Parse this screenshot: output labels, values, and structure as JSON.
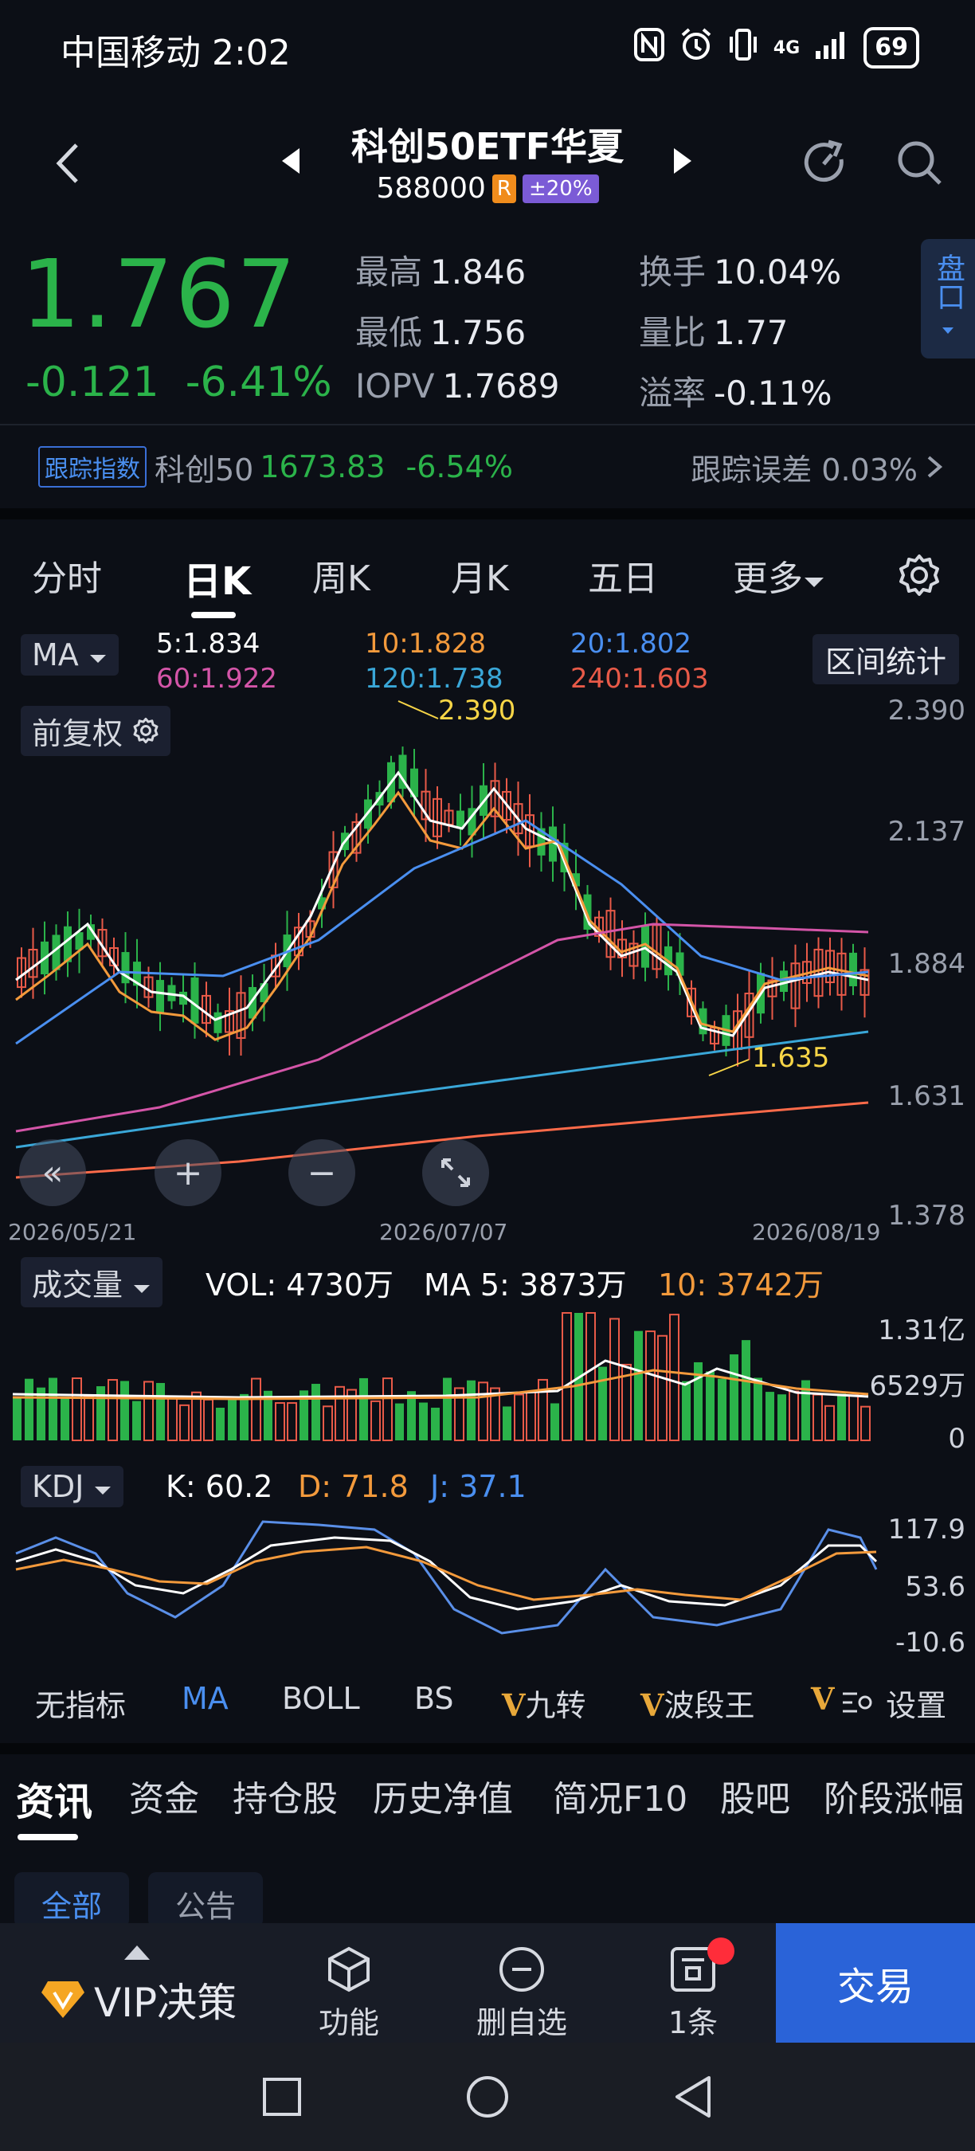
{
  "status_bar": {
    "carrier_time": "中国移动 2:02",
    "network": "4G",
    "battery": "69"
  },
  "header": {
    "title": "科创50ETF华夏",
    "code": "588000",
    "tag_r": "R",
    "tag_limit": "±20%"
  },
  "quote": {
    "price": "1.767",
    "change": "-0.121",
    "change_pct": "-6.41%",
    "high_label": "最高",
    "high": "1.846",
    "low_label": "最低",
    "low": "1.756",
    "iopv_label": "IOPV",
    "iopv": "1.7689",
    "turnover_label": "换手",
    "turnover": "10.04%",
    "vol_ratio_label": "量比",
    "vol_ratio": "1.77",
    "premium_label": "溢率",
    "premium": "-0.11%",
    "pankou": "盘口"
  },
  "tracking": {
    "tag": "跟踪指数",
    "index_name": "科创50",
    "index_value": "1673.83",
    "index_pct": "-6.54%",
    "error_text": "跟踪误差 0.03%"
  },
  "period_tabs": [
    "分时",
    "日K",
    "周K",
    "月K",
    "五日",
    "更多"
  ],
  "ma_legend": {
    "dropdown": "MA",
    "fq": "前复权",
    "range_stat": "区间统计",
    "ma5": "5:1.834",
    "ma10": "10:1.828",
    "ma20": "20:1.802",
    "ma60": "60:1.922",
    "ma120": "120:1.738",
    "ma240": "240:1.603",
    "high_mark": "2.390",
    "low_mark": "1.635"
  },
  "kline_axis": {
    "y_labels": [
      "2.390",
      "2.137",
      "1.884",
      "1.631",
      "1.378"
    ],
    "dates": [
      "2026/05/21",
      "2026/07/07",
      "2026/08/19"
    ]
  },
  "volume": {
    "dropdown": "成交量",
    "vol": "VOL: 4730万",
    "ma5": "MA 5: 3873万",
    "ma10": "10: 3742万",
    "y_labels": [
      "1.31亿",
      "6529万",
      "0"
    ]
  },
  "kdj": {
    "dropdown": "KDJ",
    "k": "K: 60.2",
    "d": "D: 71.8",
    "j": "J: 37.1",
    "y_labels": [
      "117.9",
      "53.6",
      "-10.6"
    ]
  },
  "indicators": {
    "none": "无指标",
    "ma": "MA",
    "boll": "BOLL",
    "bs": "BS",
    "v": "V",
    "jiuzhuan": "九转",
    "boduanwang": "波段王",
    "settings": "设置"
  },
  "news_tabs": [
    "资讯",
    "资金",
    "持仓股",
    "历史净值",
    "简况F10",
    "股吧",
    "阶段涨幅"
  ],
  "news_chips": [
    "全部",
    "公告"
  ],
  "bottom_bar": {
    "vip": "VIP决策",
    "func": "功能",
    "remove_watch": "删自选",
    "messages": "1条",
    "trade": "交易"
  },
  "colors": {
    "up": "#e85a48",
    "down": "#2bb34a",
    "accent": "#4a8ff0",
    "trade_button": "#2a63d8"
  }
}
